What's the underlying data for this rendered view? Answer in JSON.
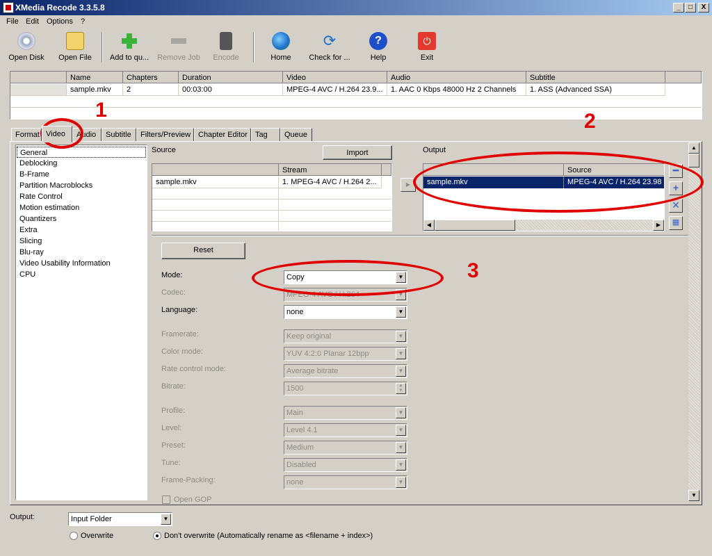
{
  "window": {
    "title": "XMedia Recode 3.3.5.8",
    "buttons": [
      "_",
      "□",
      "X"
    ]
  },
  "menu": [
    "File",
    "Edit",
    "Options",
    "?"
  ],
  "toolbar": {
    "open_disk": "Open Disk",
    "open_file": "Open File",
    "add_to_queue": "Add to qu...",
    "remove_job": "Remove Job",
    "encode": "Encode",
    "home": "Home",
    "check_for": "Check for ...",
    "help": "Help",
    "exit": "Exit"
  },
  "file_grid": {
    "headers": [
      "Name",
      "Chapters",
      "Duration",
      "Video",
      "Audio",
      "Subtitle"
    ],
    "row": [
      "sample.mkv",
      "2",
      "00:03:00",
      "MPEG-4 AVC / H.264 23.9...",
      "1. AAC  0 Kbps 48000 Hz 2 Channels",
      "1. ASS (Advanced SSA)"
    ]
  },
  "tabs": [
    "Format",
    "Video",
    "Audio",
    "Subtitle",
    "Filters/Preview",
    "Chapter Editor",
    "Tag",
    "Queue"
  ],
  "nav": [
    "General",
    "Deblocking",
    "B-Frame",
    "Partition Macroblocks",
    "Rate Control",
    "Motion estimation",
    "Quantizers",
    "Extra",
    "Slicing",
    "Blu-ray",
    "Video Usability Information",
    "CPU"
  ],
  "source": {
    "label": "Source",
    "import": "Import",
    "header_stream": "Stream",
    "file": "sample.mkv",
    "stream": "1. MPEG-4 AVC / H.264 2..."
  },
  "output": {
    "label": "Output",
    "header_source": "Source",
    "file": "sample.mkv",
    "source": "MPEG-4 AVC / H.264 23.98 H"
  },
  "settings": {
    "reset": "Reset",
    "mode_label": "Mode:",
    "mode_value": "Copy",
    "codec_label": "Codec:",
    "codec_value": "MPEG-4 AVC / H.264",
    "language_label": "Language:",
    "language_value": "none",
    "framerate_label": "Framerate:",
    "framerate_value": "Keep original",
    "color_label": "Color mode:",
    "color_value": "YUV 4:2:0 Planar 12bpp",
    "rcm_label": "Rate control mode:",
    "rcm_value": "Average bitrate",
    "bitrate_label": "Bitrate:",
    "bitrate_value": "1500",
    "profile_label": "Profile:",
    "profile_value": "Main",
    "level_label": "Level:",
    "level_value": "Level 4.1",
    "preset_label": "Preset:",
    "preset_value": "Medium",
    "tune_label": "Tune:",
    "tune_value": "Disabled",
    "fp_label": "Frame-Packing:",
    "fp_value": "none",
    "open_gop": "Open GOP"
  },
  "bottom": {
    "output_label": "Output:",
    "output_value": "Input Folder",
    "overwrite": "Overwrite",
    "dont_overwrite": "Don't overwrite (Automatically rename as <filename + index>)"
  },
  "annotations": [
    "1",
    "2",
    "3"
  ],
  "colors": {
    "annotation": "#e00000",
    "selection": "#0a246a",
    "title_start": "#0a246a",
    "title_end": "#a6caf0"
  }
}
